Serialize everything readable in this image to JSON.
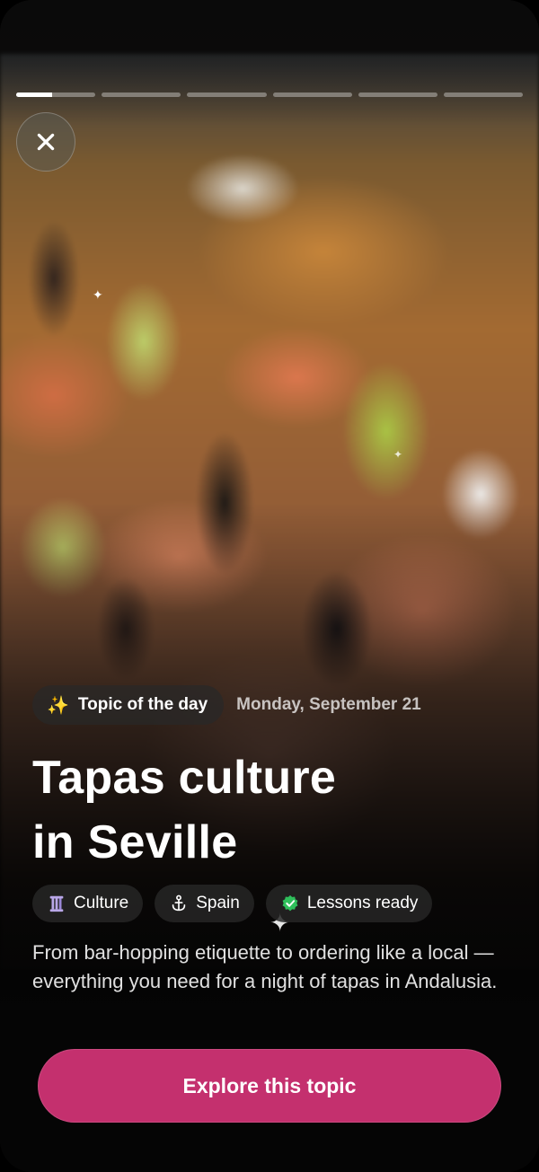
{
  "story": {
    "segment_count": 6,
    "active_segment": 1,
    "active_progress": 0.45
  },
  "close": {
    "icon": "close-icon"
  },
  "meta": {
    "topic_label": "Topic of the day",
    "topic_icon": "sparkles-icon",
    "date": "Monday, September 21"
  },
  "title": {
    "line1": "Tapas culture",
    "line2": "in Seville"
  },
  "tags": [
    {
      "label": "Culture",
      "icon": "column-icon"
    },
    {
      "label": "Spain",
      "icon": "anchor-icon"
    },
    {
      "label": "Lessons ready",
      "icon": "check-badge-icon"
    }
  ],
  "description": "From bar-hopping etiquette to ordering like a local — everything you need for a night of tapas in Andalusia.",
  "cta": {
    "label": "Explore this topic"
  },
  "colors": {
    "cta": "#c4306e",
    "check": "#2fbf5b",
    "sparkle": "#ffd86b"
  }
}
